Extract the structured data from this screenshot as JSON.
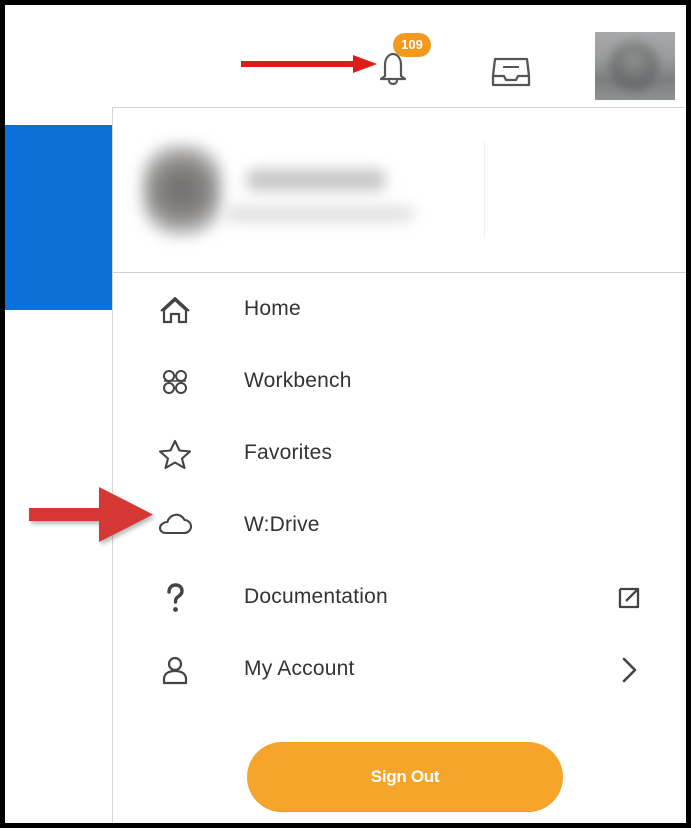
{
  "notifications": {
    "count": "109"
  },
  "menu": {
    "items": [
      {
        "label": "Home",
        "icon": "home-icon"
      },
      {
        "label": "Workbench",
        "icon": "workbench-icon"
      },
      {
        "label": "Favorites",
        "icon": "star-icon"
      },
      {
        "label": "W:Drive",
        "icon": "cloud-icon"
      },
      {
        "label": "Documentation",
        "icon": "question-icon"
      },
      {
        "label": "My Account",
        "icon": "user-icon"
      }
    ],
    "sign_out_label": "Sign Out"
  },
  "colors": {
    "accent_blue": "#0b6fd8",
    "badge": "#f39a1d",
    "sign_out_button": "#f7a52a",
    "annotation_red": "#dd1c1c"
  }
}
